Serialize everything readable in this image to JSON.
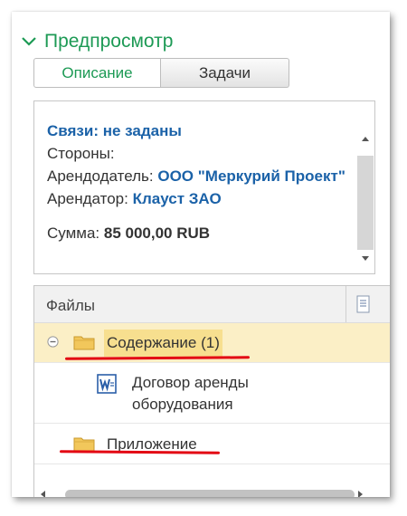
{
  "preview": {
    "title": "Предпросмотр",
    "toggle_icon": "chevron-down-icon",
    "accent_color": "#1d9a55"
  },
  "tabs": [
    {
      "label": "Описание",
      "active": true
    },
    {
      "label": "Задачи",
      "active": false
    }
  ],
  "description": {
    "links_line": "Связи: не заданы",
    "parties_label": "Стороны:",
    "lessor_label": "Арендодатель:",
    "lessor_value": "ООО \"Меркурий Проект\"",
    "lessee_label": "Арендатор:",
    "lessee_value": "Клауст ЗАО",
    "sum_label": "Сумма:",
    "sum_value": "85 000,00 RUB",
    "link_color": "#1b62a8"
  },
  "files": {
    "header": "Файлы",
    "header_icon": "document-icon",
    "rows": [
      {
        "type": "folder",
        "label": "Содержание (1)",
        "expanded": true,
        "selected": true,
        "icon": "folder-icon"
      },
      {
        "type": "document",
        "label_line1": "Договор аренды",
        "label_line2": "оборудования",
        "icon": "word-document-icon"
      },
      {
        "type": "folder",
        "label": "Приложение",
        "icon": "folder-icon"
      }
    ],
    "selection_color": "#fbefc6"
  },
  "annotations": {
    "underline_color": "#e30613"
  }
}
